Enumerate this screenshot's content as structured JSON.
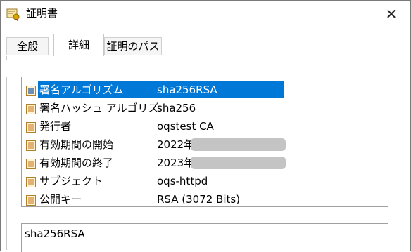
{
  "window": {
    "title": "証明書",
    "close_glyph": "✕"
  },
  "tabs": [
    {
      "label": "全般",
      "active": false
    },
    {
      "label": "詳細",
      "active": true
    },
    {
      "label": "証明のパス",
      "active": false
    }
  ],
  "fields": [
    {
      "field": "署名アルゴリズム",
      "value": "sha256RSA",
      "selected": true
    },
    {
      "field": "署名ハッシュ アルゴリズ...",
      "value": "sha256",
      "selected": false
    },
    {
      "field": "発行者",
      "value": "oqstest CA",
      "selected": false
    },
    {
      "field": "有効期間の開始",
      "value": "2022年",
      "redacted": true,
      "selected": false
    },
    {
      "field": "有効期間の終了",
      "value": "2023年",
      "redacted": true,
      "selected": false
    },
    {
      "field": "サブジェクト",
      "value": "oqs-httpd",
      "selected": false
    },
    {
      "field": "公開キー",
      "value": "RSA (3072 Bits)",
      "selected": false
    }
  ],
  "detail": {
    "value": "sha256RSA"
  },
  "colors": {
    "selection": "#0078d7",
    "redaction": "#c4c4c4"
  },
  "icons": {
    "app": "certificate-icon",
    "field": "certificate-field-icon",
    "scroll_down": "chevron-down-icon"
  }
}
